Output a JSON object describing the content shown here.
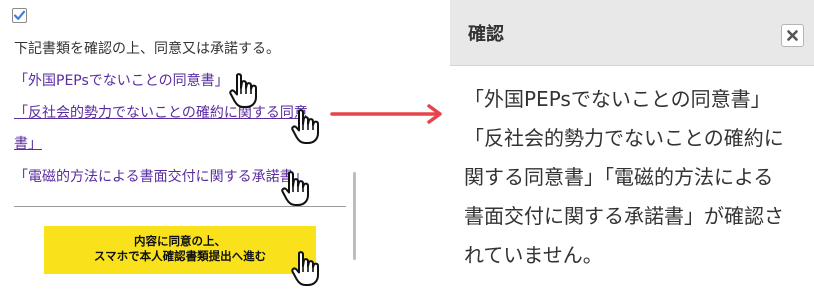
{
  "consent": {
    "checked": true,
    "text": "下記書類を確認の上、同意又は承諾する。"
  },
  "documents": {
    "link_1": "「外国PEPsでないことの同意書」",
    "link_2_line_1": "「反社会的勢力でないことの確約に関する同意",
    "link_2_line_2": "書」",
    "link_3": "「電磁的方法による書面交付に関する承諾書」"
  },
  "proceed_button": {
    "line_1": "内容に同意の上、",
    "line_2": "スマホで本人確認書類提出へ進む"
  },
  "modal": {
    "title": "確認",
    "close_icon": "close-icon",
    "message_lines": [
      "「外国PEPsでないことの同意書」",
      "「反社会的勢力でないことの確約に",
      "関する同意書」「電磁的方法による",
      "書面交付に関する承諾書」が確認さ",
      "れていません。"
    ]
  },
  "colors": {
    "link": "#5a2ca0",
    "button_bg": "#f9e21c",
    "arrow": "#e8424a",
    "modal_header_bg": "#e8e8e8",
    "checkbox_check": "#3d7fd6"
  },
  "icons": {
    "pointer": "hand-pointer-icon",
    "arrow": "arrow-right-icon",
    "check": "checkmark-icon"
  }
}
